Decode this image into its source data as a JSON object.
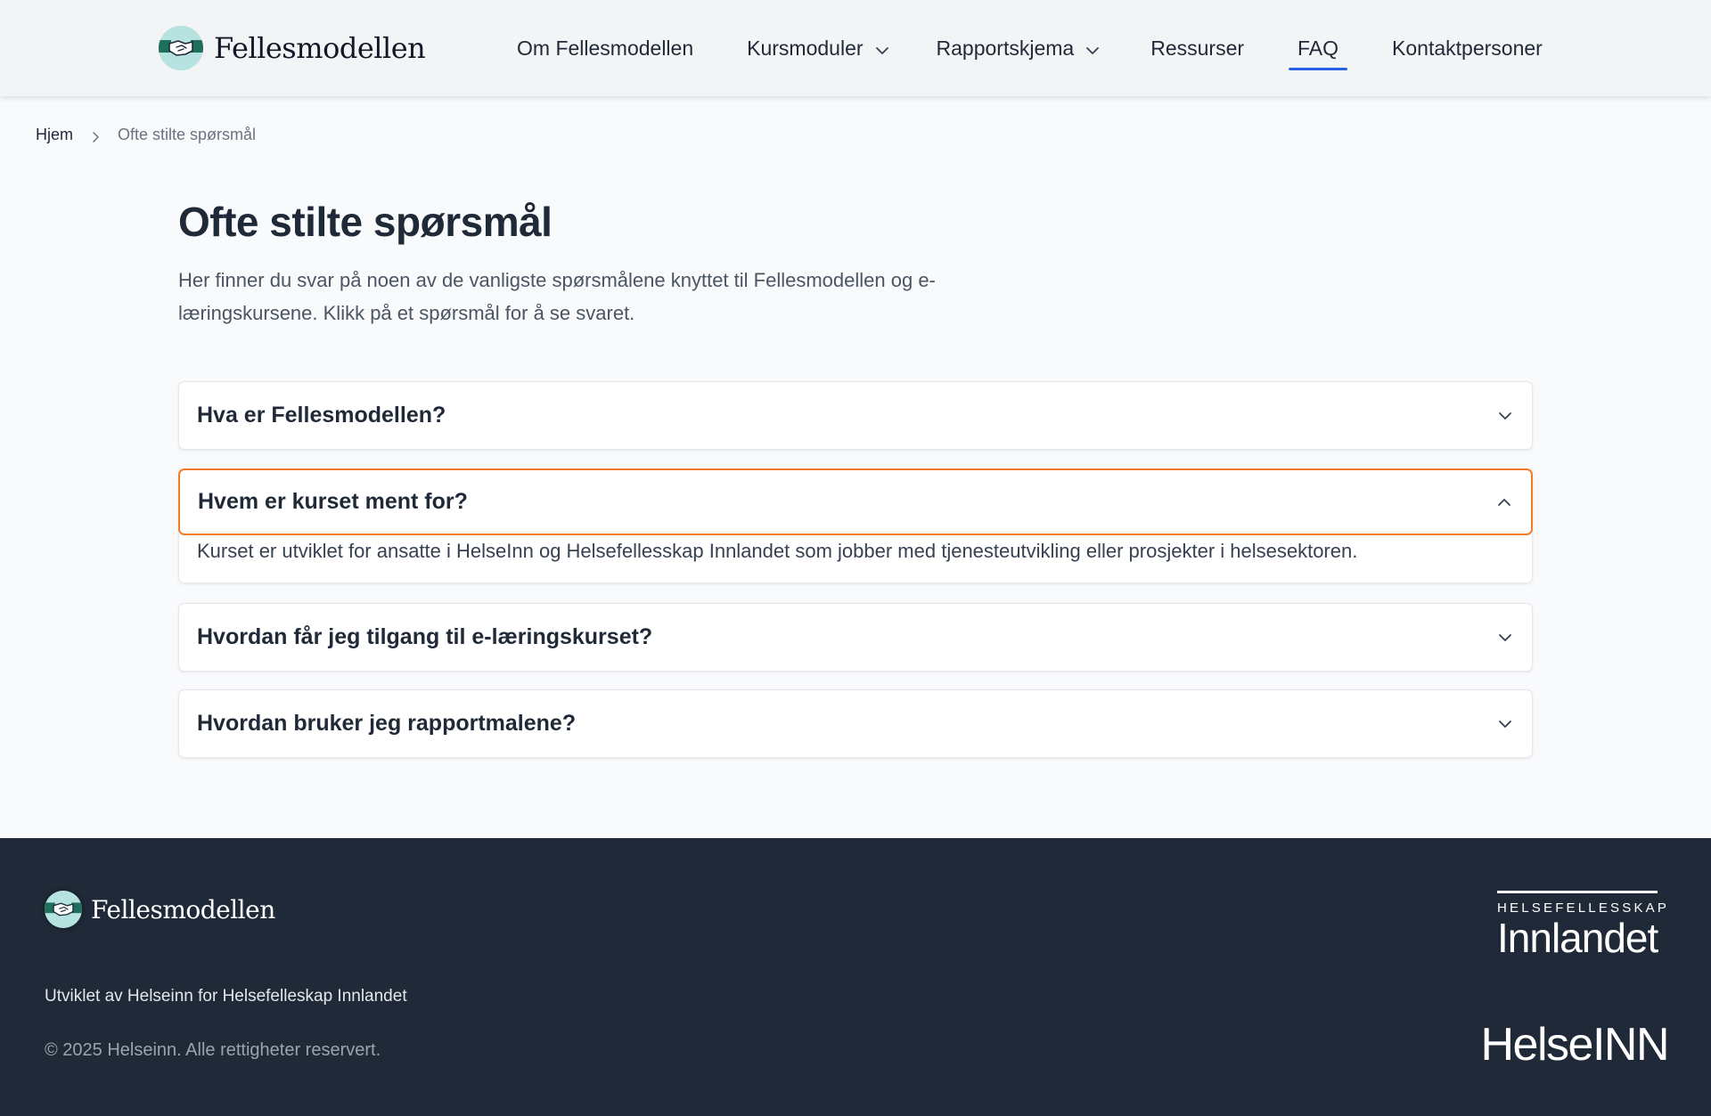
{
  "header": {
    "brand": "Fellesmodellen",
    "nav": [
      {
        "label": "Om Fellesmodellen",
        "has_dropdown": false,
        "active": false
      },
      {
        "label": "Kursmoduler",
        "has_dropdown": true,
        "active": false
      },
      {
        "label": "Rapportskjema",
        "has_dropdown": true,
        "active": false
      },
      {
        "label": "Ressurser",
        "has_dropdown": false,
        "active": false
      },
      {
        "label": "FAQ",
        "has_dropdown": false,
        "active": true
      },
      {
        "label": "Kontaktpersoner",
        "has_dropdown": false,
        "active": false
      }
    ],
    "active_indicator_color": "#2563eb"
  },
  "breadcrumb": {
    "home": "Hjem",
    "current": "Ofte stilte spørsmål"
  },
  "main": {
    "title": "Ofte stilte spørsmål",
    "intro_line1": "Her finner du svar på noen av de vanligste spørsmålene knyttet til Fellesmodellen og e-",
    "intro_line2": "læringskursene. Klikk på et spørsmål for å se svaret.",
    "faq": [
      {
        "question": "Hva er Fellesmodellen?",
        "open": false,
        "answer": ""
      },
      {
        "question": "Hvem er kurset ment for?",
        "open": true,
        "answer": "Kurset er utviklet for ansatte i HelseInn og Helsefellesskap Innlandet som jobber med tjenesteutvikling eller prosjekter i helsesektoren."
      },
      {
        "question": "Hvordan får jeg tilgang til e-læringskurset?",
        "open": false,
        "answer": ""
      },
      {
        "question": "Hvordan bruker jeg rapportmalene?",
        "open": false,
        "answer": ""
      }
    ],
    "focus_color": "#f07c2a"
  },
  "footer": {
    "brand": "Fellesmodellen",
    "tagline": "Utviklet av Helseinn for Helsefelleskap Innlandet",
    "copyright": "© 2025 Helseinn. Alle rettigheter reservert.",
    "partner1_small": "HELSEFELLESSKAP",
    "partner1_big": "Innlandet",
    "partner2": "HelseINN",
    "background": "#1f2937"
  },
  "icons": {
    "brand_logo": "handshake-icon",
    "dropdown": "chevron-down-icon",
    "breadcrumb_separator": "chevron-right-icon",
    "faq_collapsed": "chevron-down-icon",
    "faq_expanded": "chevron-up-icon"
  }
}
